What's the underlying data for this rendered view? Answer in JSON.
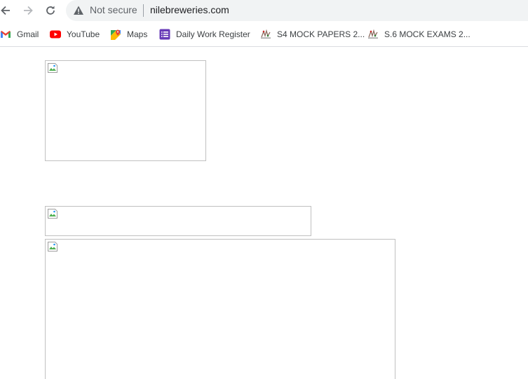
{
  "browser": {
    "security_label": "Not secure",
    "url": "nilebreweries.com",
    "icons": {
      "back": "back-arrow-icon",
      "forward": "forward-arrow-icon",
      "reload": "reload-icon",
      "warning": "warning-triangle-icon"
    }
  },
  "bookmarks": [
    {
      "label": "Gmail",
      "icon": "gmail-icon"
    },
    {
      "label": "YouTube",
      "icon": "youtube-icon"
    },
    {
      "label": "Maps",
      "icon": "maps-icon"
    },
    {
      "label": "Daily Work Register",
      "icon": "forms-icon"
    },
    {
      "label": "S4 MOCK PAPERS 2...",
      "icon": "site-favicon-icon"
    },
    {
      "label": "S.6 MOCK EXAMS 2...",
      "icon": "site-favicon-icon"
    }
  ],
  "colors": {
    "omnibox_bg": "#f1f3f4",
    "youtube_red": "#ff0000",
    "forms_purple": "#673ab7"
  }
}
